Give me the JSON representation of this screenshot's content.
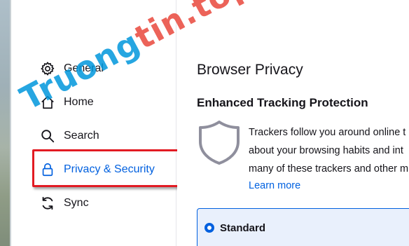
{
  "sidebar": {
    "items": [
      {
        "label": "General",
        "icon": "gear-icon"
      },
      {
        "label": "Home",
        "icon": "home-icon"
      },
      {
        "label": "Search",
        "icon": "search-icon"
      },
      {
        "label": "Privacy & Security",
        "icon": "lock-icon",
        "selected": true
      },
      {
        "label": "Sync",
        "icon": "sync-icon"
      }
    ]
  },
  "main": {
    "page_title": "Browser Privacy",
    "section_title": "Enhanced Tracking Protection",
    "description_lines": [
      "Trackers follow you around online t",
      "about your browsing habits and int",
      "many of these trackers and other m"
    ],
    "learn_more": "Learn more",
    "standard_label": "Standard"
  },
  "watermark": {
    "part_a": "Truong",
    "part_b": "tin.top"
  },
  "colors": {
    "accent": "#0060df",
    "highlight": "#e21b23",
    "link": "#0061e0"
  }
}
